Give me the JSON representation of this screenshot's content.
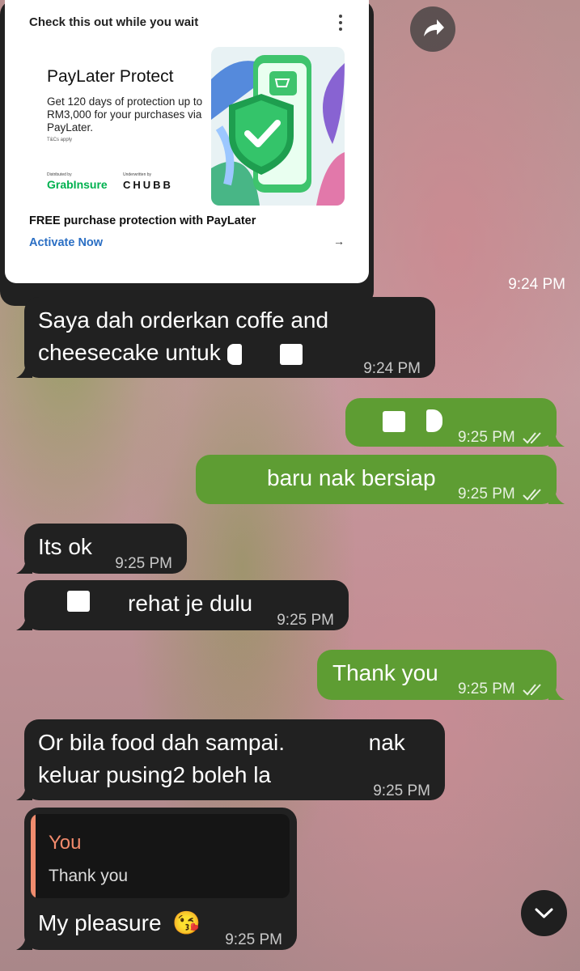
{
  "card": {
    "header": "Check this out while you wait",
    "promo_title": "PayLater Protect",
    "promo_body": "Get 120 days of protection up to RM3,000 for your purchases via PayLater.",
    "promo_tnc": "T&Cs apply",
    "distributed_by": "Distributed by",
    "underwritten_by": "Underwritten by",
    "grab_logo": "GrabInsure",
    "chubb_logo": "CHUBB",
    "free_text": "FREE purchase protection with PayLater",
    "activate_label": "Activate Now",
    "arrow": "→",
    "time": "9:24 PM"
  },
  "messages": [
    {
      "dir": "in",
      "line1": "Saya dah orderkan coffe and",
      "line2": "cheesecake untuk",
      "time": "9:24 PM"
    },
    {
      "dir": "out",
      "text": "",
      "time": "9:25 PM"
    },
    {
      "dir": "out",
      "text": "baru nak bersiap",
      "time": "9:25 PM"
    },
    {
      "dir": "in",
      "text": "Its ok",
      "time": "9:25 PM"
    },
    {
      "dir": "in",
      "text": "rehat je dulu",
      "time": "9:25 PM"
    },
    {
      "dir": "out",
      "text": "Thank you",
      "time": "9:25 PM"
    },
    {
      "dir": "in",
      "line1": "Or bila food dah sampai.",
      "line1b": "nak",
      "line2": "keluar pusing2 boleh la",
      "time": "9:25 PM"
    },
    {
      "dir": "in",
      "reply_name": "You",
      "reply_text": "Thank you",
      "text": "My pleasure",
      "emoji": "😘",
      "time": "9:25 PM"
    }
  ],
  "colors": {
    "incoming": "#212121",
    "outgoing": "#5e9d33",
    "reply_accent": "#f08c6e",
    "link": "#2b6fc4"
  }
}
